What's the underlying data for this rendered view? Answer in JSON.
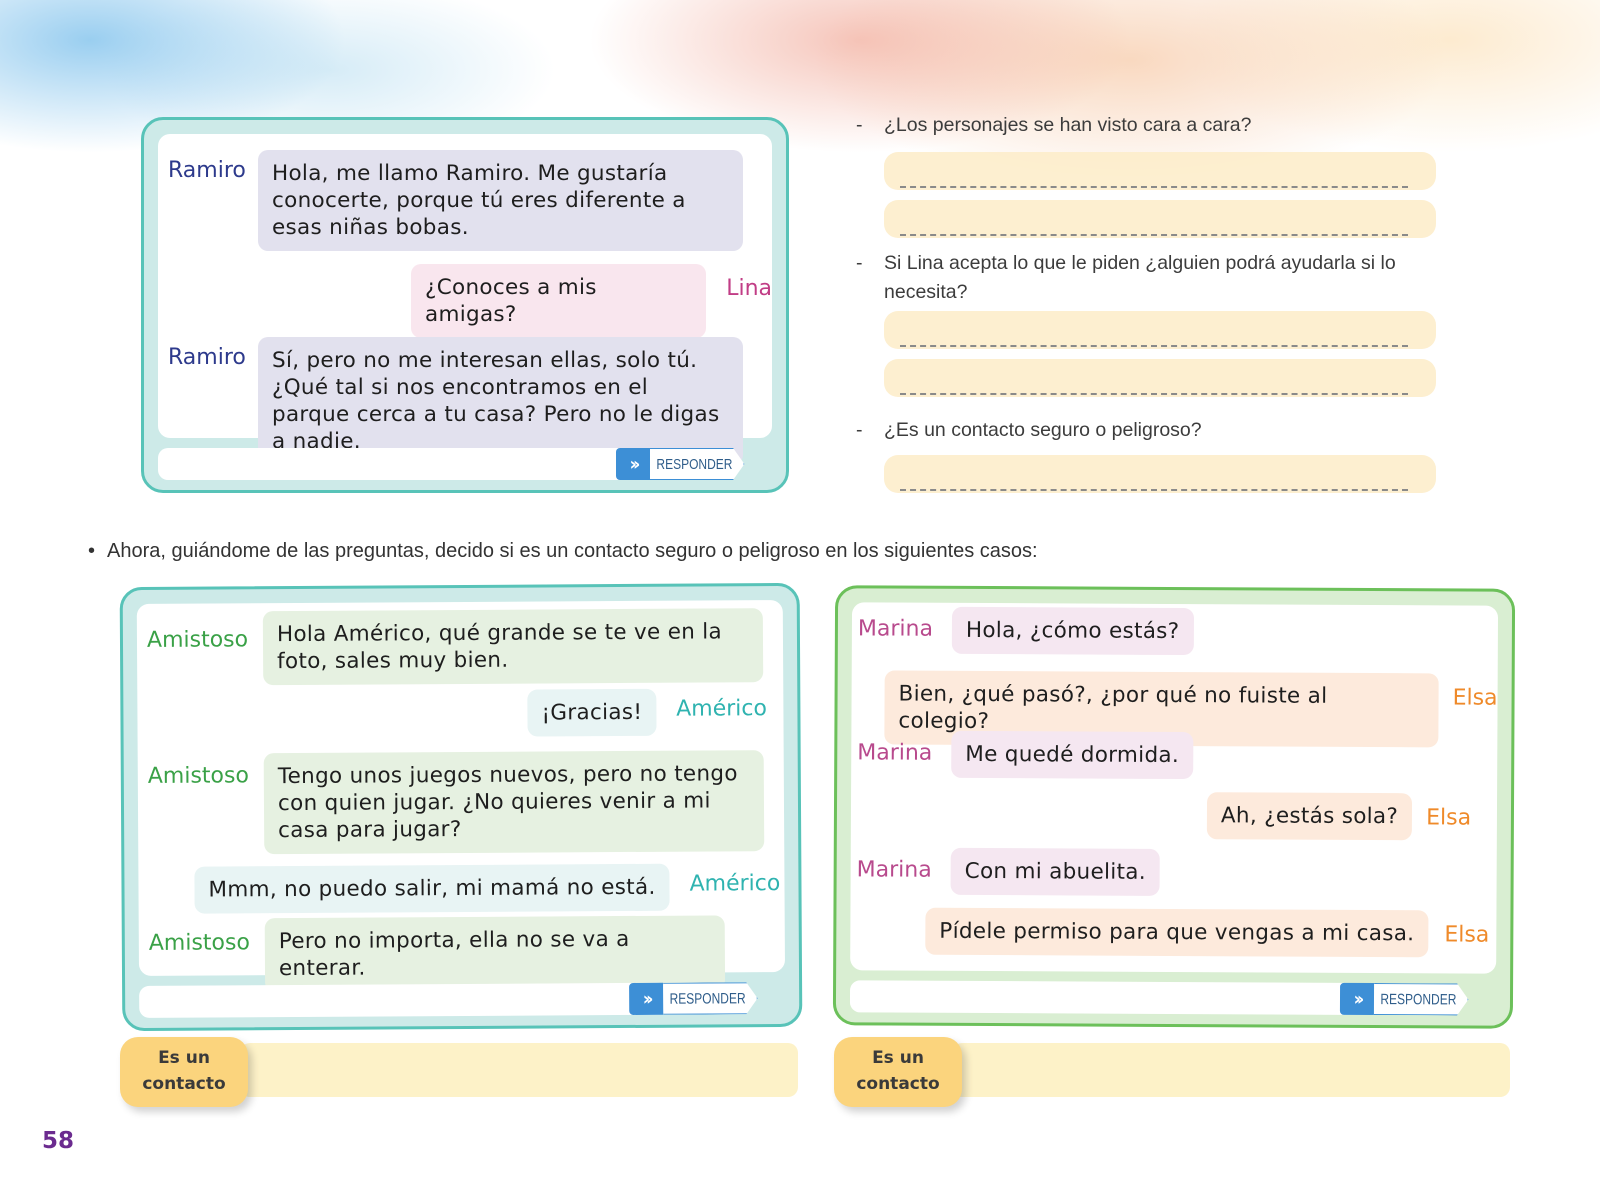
{
  "page_number": "58",
  "chat1": {
    "messages": [
      {
        "speaker": "Ramiro",
        "text": "Hola, me llamo Ramiro. Me gustaría conocerte, porque tú eres diferente a esas niñas bobas."
      },
      {
        "speaker": "Lina",
        "text": "¿Conoces a mis amigas?"
      },
      {
        "speaker": "Ramiro",
        "text": "Sí, pero no me interesan ellas, solo tú. ¿Qué tal si nos encontramos en el parque cerca a tu casa? Pero no le digas a nadie."
      }
    ],
    "reply_label": "RESPONDER"
  },
  "questions": [
    {
      "dash": "-",
      "text": "¿Los personajes se han visto cara a cara?"
    },
    {
      "dash": "-",
      "text": "Si Lina acepta lo que le piden ¿alguien podrá ayudarla si lo necesita?"
    },
    {
      "dash": "-",
      "text": "¿Es un contacto seguro o peligroso?"
    }
  ],
  "instruction": "Ahora, guiándome de las preguntas, decido si es un contacto seguro o peligroso en los siguientes casos:",
  "chat2": {
    "messages": [
      {
        "speaker": "Amistoso",
        "text": "Hola Américo, qué grande se te ve en la foto, sales muy bien."
      },
      {
        "speaker": "Américo",
        "text": "¡Gracias!"
      },
      {
        "speaker": "Amistoso",
        "text": "Tengo unos juegos nuevos, pero no tengo con quien jugar. ¿No quieres venir a mi casa para jugar?"
      },
      {
        "speaker": "Américo",
        "text": "Mmm, no puedo salir, mi mamá no está."
      },
      {
        "speaker": "Amistoso",
        "text": "Pero no importa, ella no se va a enterar."
      }
    ],
    "reply_label": "RESPONDER",
    "tag_label": "Es un contacto"
  },
  "chat3": {
    "messages": [
      {
        "speaker": "Marina",
        "text": "Hola, ¿cómo estás?"
      },
      {
        "speaker": "Elsa",
        "text": "Bien, ¿qué pasó?, ¿por qué no fuiste al colegio?"
      },
      {
        "speaker": "Marina",
        "text": "Me quedé dormida."
      },
      {
        "speaker": "Elsa",
        "text": "Ah, ¿estás sola?"
      },
      {
        "speaker": "Marina",
        "text": "Con mi abuelita."
      },
      {
        "speaker": "Elsa",
        "text": "Pídele permiso para que vengas a mi casa."
      }
    ],
    "reply_label": "RESPONDER",
    "tag_label": "Es un contacto"
  },
  "colors": {
    "teal_border": "#58c3b8",
    "green_border": "#6cc05a",
    "reply_blue": "#3d8fd6",
    "highlight": "#fdecc8",
    "tag_yellow": "#fbd47d",
    "page_number": "#6b2b8f"
  }
}
